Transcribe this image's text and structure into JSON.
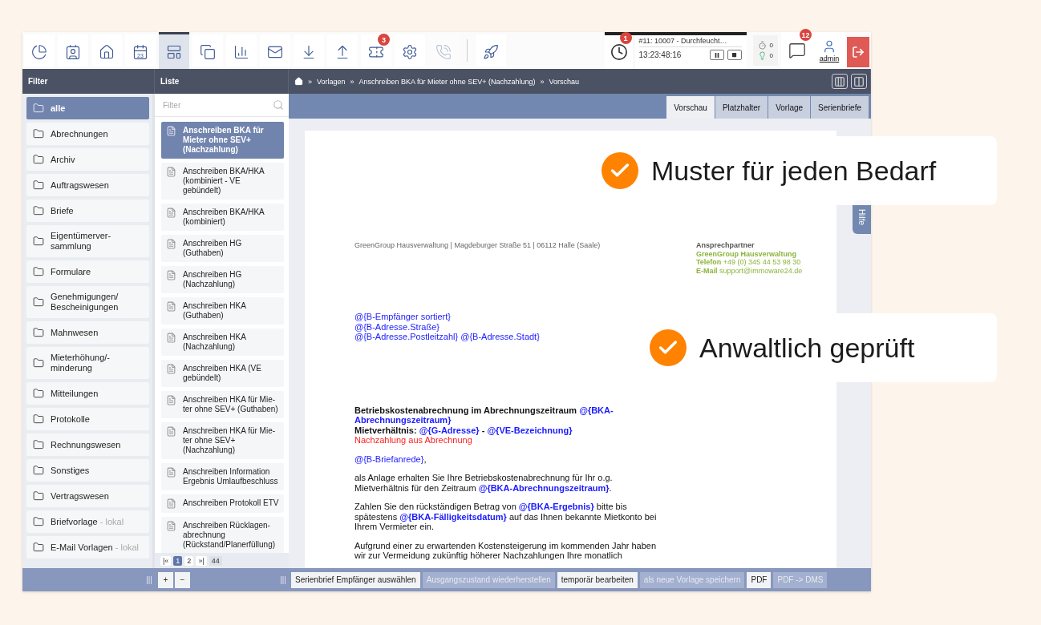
{
  "toolbar": {
    "tools": [
      {
        "selected": false,
        "disabled": false
      },
      {
        "selected": false,
        "disabled": false
      },
      {
        "selected": false,
        "disabled": false
      },
      {
        "selected": false,
        "disabled": false,
        "day": "23"
      },
      {
        "selected": true,
        "disabled": false
      },
      {
        "selected": false,
        "disabled": false
      },
      {
        "selected": false,
        "disabled": false
      },
      {
        "selected": false,
        "disabled": false
      },
      {
        "selected": false,
        "disabled": false
      },
      {
        "selected": false,
        "disabled": false
      },
      {
        "selected": false,
        "disabled": false,
        "badge": "3"
      },
      {
        "selected": false,
        "disabled": false
      },
      {
        "selected": false,
        "disabled": true
      },
      {
        "selected": false,
        "disabled": false
      }
    ],
    "timer": {
      "badge": "1",
      "task": "#11: 10007 - Durchfeucht…",
      "elapsed": "13:23:48:16"
    },
    "counters": [
      {
        "count": "0"
      },
      {
        "count": "0"
      }
    ],
    "messages": {
      "badge": "12"
    },
    "user": {
      "name": "admin"
    }
  },
  "header": {
    "filter_title": "Filter",
    "list_title": "Liste",
    "breadcrumb": [
      {
        "separator": "»",
        "label": "Vorlagen"
      },
      {
        "separator": "»",
        "label": "Anschreiben BKA für Mieter ohne SEV+ (Nachzahlung)"
      },
      {
        "separator": "»",
        "label": "Vorschau"
      }
    ]
  },
  "filter": {
    "items": [
      {
        "label": "alle",
        "selected": true
      },
      {
        "label": "Abrechnungen",
        "selected": false
      },
      {
        "label": "Archiv",
        "selected": false
      },
      {
        "label": "Auftragswesen",
        "selected": false
      },
      {
        "label": "Briefe",
        "selected": false
      },
      {
        "label": "Eigentümerver-\nsammlung",
        "selected": false
      },
      {
        "label": "Formulare",
        "selected": false
      },
      {
        "label": "Genehmigungen/\nBescheinigungen",
        "selected": false
      },
      {
        "label": "Mahnwesen",
        "selected": false
      },
      {
        "label": "Mieterhöhung/-\nminderung",
        "selected": false
      },
      {
        "label": "Mitteilungen",
        "selected": false
      },
      {
        "label": "Protokolle",
        "selected": false
      },
      {
        "label": "Rechnungswesen",
        "selected": false
      },
      {
        "label": "Sonstiges",
        "selected": false
      },
      {
        "label": "Vertragswesen",
        "selected": false
      },
      {
        "label": "Briefvorlage",
        "suffix": "- lokal",
        "selected": false
      },
      {
        "label": "E-Mail Vorlagen",
        "suffix": "- lokal",
        "selected": false
      }
    ]
  },
  "list": {
    "placeholder": "Filter",
    "items": [
      {
        "label": "Anschreiben BKA für\nMieter ohne SEV+\n(Nachzahlung)",
        "selected": true
      },
      {
        "label": "Anschreiben BKA/HKA\n(kombiniert - VE\ngebündelt)",
        "selected": false
      },
      {
        "label": "Anschreiben BKA/HKA\n(kombiniert)",
        "selected": false
      },
      {
        "label": "Anschreiben HG\n(Guthaben)",
        "selected": false
      },
      {
        "label": "Anschreiben HG\n(Nachzahlung)",
        "selected": false
      },
      {
        "label": "Anschreiben HKA\n(Guthaben)",
        "selected": false
      },
      {
        "label": "Anschreiben HKA\n(Nachzahlung)",
        "selected": false
      },
      {
        "label": "Anschreiben HKA (VE\ngebündelt)",
        "selected": false
      },
      {
        "label": "Anschreiben HKA für Mie-\nter ohne SEV+ (Guthaben)",
        "selected": false
      },
      {
        "label": "Anschreiben HKA für Mie-\nter ohne SEV+\n(Nachzahlung)",
        "selected": false
      },
      {
        "label": "Anschreiben Information\nErgebnis Umlaufbeschluss",
        "selected": false
      },
      {
        "label": "Anschreiben Protokoll ETV",
        "selected": false
      },
      {
        "label": "Anschreiben Rücklagen-\nabrechnung\n(Rückstand/Planerfüllung)",
        "selected": false
      }
    ],
    "pagination": {
      "first": "|«",
      "pages": [
        {
          "label": "1",
          "selected": true
        },
        {
          "label": "2",
          "selected": false
        }
      ],
      "last": "»|",
      "total": "44"
    }
  },
  "tabs": [
    {
      "label": "Vorschau",
      "selected": true
    },
    {
      "label": "Platzhalter",
      "selected": false
    },
    {
      "label": "Vorlage",
      "selected": false
    },
    {
      "label": "Serienbriefe",
      "selected": false
    }
  ],
  "help_tab": "Hilfe",
  "document": {
    "sender_line": "GreenGroup Hausverwaltung | Magdeburger Straße 51 | 06112 Halle (Saale)",
    "contact": [
      {
        "kind": "heading",
        "text": "Ansprechpartner"
      },
      {
        "kind": "company",
        "text": "GreenGroup Hausverwaltung"
      },
      {
        "kind": "detail",
        "text": "**Telefon** +49 (0) 345 44 53 98 30"
      },
      {
        "kind": "detail",
        "text": "**E-Mail** support@immoware24.de"
      }
    ],
    "paragraphs": [
      {
        "kind": "address",
        "lines": [
          [
            {
              "kind": "var",
              "text": "@{B-Empfänger sortiert}"
            }
          ],
          [
            {
              "kind": "var",
              "text": "@{B-Adresse.Straße}"
            }
          ],
          [
            {
              "kind": "var",
              "text": "@{B-Adresse.Postleitzahl} "
            },
            {
              "kind": "var",
              "text": "@{B-Adresse.Stadt}"
            }
          ]
        ]
      },
      {
        "kind": "subject",
        "lines": [
          [
            {
              "kind": "bold",
              "text": "Betriebskostenabrechnung im Abrechnungszeitraum "
            },
            {
              "kind": "var-bold",
              "text": "@{BKA-Abrechnungszeitraum}"
            }
          ],
          [
            {
              "kind": "bold",
              "text": "Mietverhältnis: "
            },
            {
              "kind": "var-bold",
              "text": "@{G-Adresse}"
            },
            {
              "kind": "bold",
              "text": " - "
            },
            {
              "kind": "var-bold",
              "text": "@{VE-Bezeichnung}"
            }
          ],
          [
            {
              "kind": "warning",
              "text": "Nachzahlung aus Abrechnung"
            }
          ]
        ]
      },
      {
        "kind": "body",
        "lines": [
          [
            {
              "kind": "var",
              "text": "@{B-Briefanrede}"
            },
            {
              "kind": "text",
              "text": ","
            }
          ]
        ]
      },
      {
        "kind": "body",
        "lines": [
          [
            {
              "kind": "text",
              "text": "als Anlage erhalten Sie Ihre Betriebskostenabrechnung für Ihr o.g. Mietverhältnis für den Zeitraum "
            },
            {
              "kind": "var-bold",
              "text": "@{BKA-Abrechnungszeitraum}"
            },
            {
              "kind": "text",
              "text": "."
            }
          ]
        ]
      },
      {
        "kind": "body",
        "lines": [
          [
            {
              "kind": "text",
              "text": "Zahlen Sie den rückständigen Betrag von "
            },
            {
              "kind": "var-bold",
              "text": "@{BKA-Ergebnis}"
            },
            {
              "kind": "text",
              "text": " bitte bis spätestens "
            },
            {
              "kind": "var-bold",
              "text": "@{BKA-Fälligkeitsdatum}"
            },
            {
              "kind": "text",
              "text": " auf das Ihnen bekannte Mietkonto bei Ihrem Vermieter ein."
            }
          ]
        ]
      },
      {
        "kind": "body",
        "lines": [
          [
            {
              "kind": "text",
              "text": "Aufgrund einer zu erwartenden Kostensteigerung im kommenden Jahr haben wir zur Vermeidung zukünftig höherer Nachzahlungen Ihre monatlich"
            }
          ]
        ]
      }
    ]
  },
  "bottom_bar": {
    "add": "+",
    "remove": "−",
    "actions": [
      {
        "label": "Serienbrief Empfänger auswählen",
        "disabled": false
      },
      {
        "label": "Ausgangszustand wiederherstellen",
        "disabled": true
      },
      {
        "label": "temporär bearbeiten",
        "disabled": false
      },
      {
        "label": "als neue Vorlage speichern",
        "disabled": true
      },
      {
        "label": "PDF",
        "disabled": false
      },
      {
        "label": "PDF -> DMS",
        "disabled": true
      }
    ]
  },
  "callouts": [
    {
      "text": "Muster für jeden Bedarf"
    },
    {
      "text": "Anwaltlich geprüft"
    }
  ]
}
